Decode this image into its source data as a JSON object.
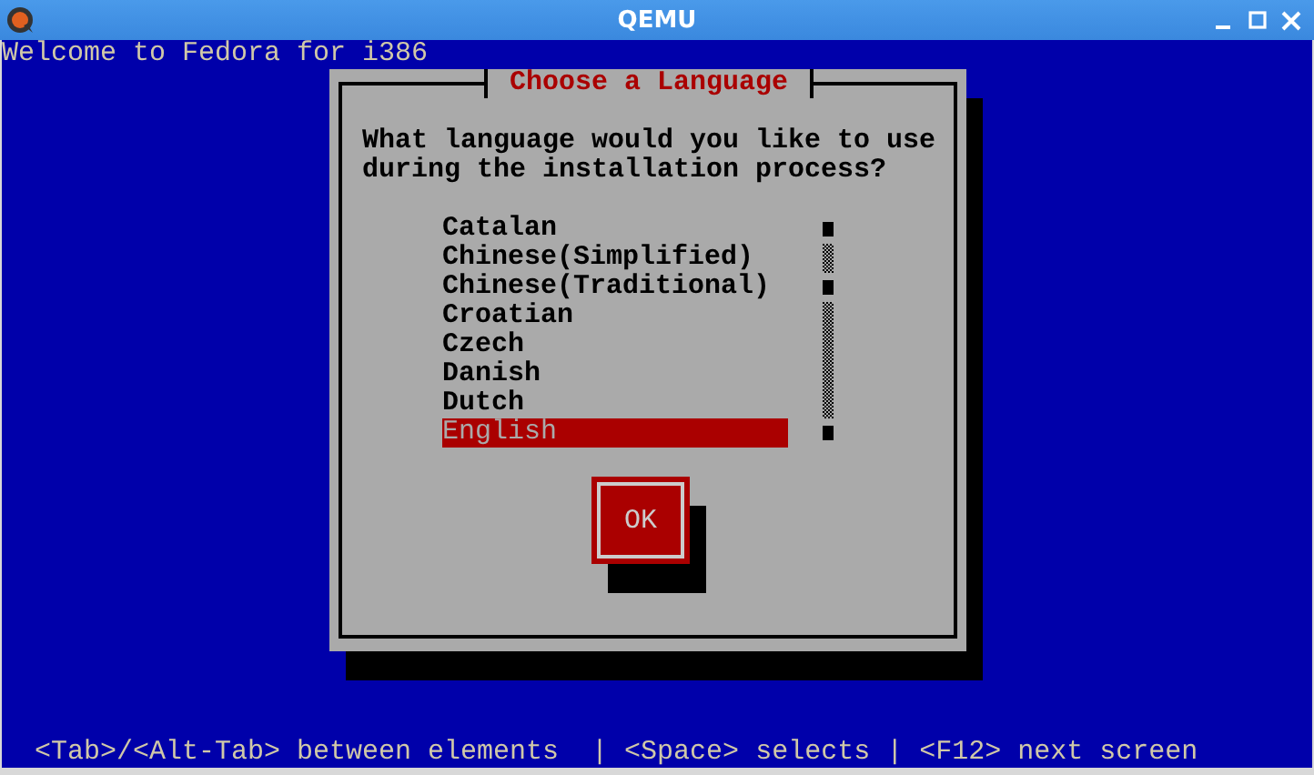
{
  "window": {
    "title": "QEMU"
  },
  "screen": {
    "header": "Welcome to Fedora for i386",
    "dialog": {
      "title": "Choose a Language",
      "prompt": "What language would you like to use during the installation process?",
      "languages": [
        {
          "label": "Catalan",
          "selected": false
        },
        {
          "label": "Chinese(Simplified)",
          "selected": false
        },
        {
          "label": "Chinese(Traditional)",
          "selected": false
        },
        {
          "label": "Croatian",
          "selected": false
        },
        {
          "label": "Czech",
          "selected": false
        },
        {
          "label": "Danish",
          "selected": false
        },
        {
          "label": "Dutch",
          "selected": false
        },
        {
          "label": "English",
          "selected": true
        }
      ],
      "button": "OK"
    },
    "help_line": "<Tab>/<Alt-Tab> between elements  | <Space> selects | <F12> next screen"
  }
}
